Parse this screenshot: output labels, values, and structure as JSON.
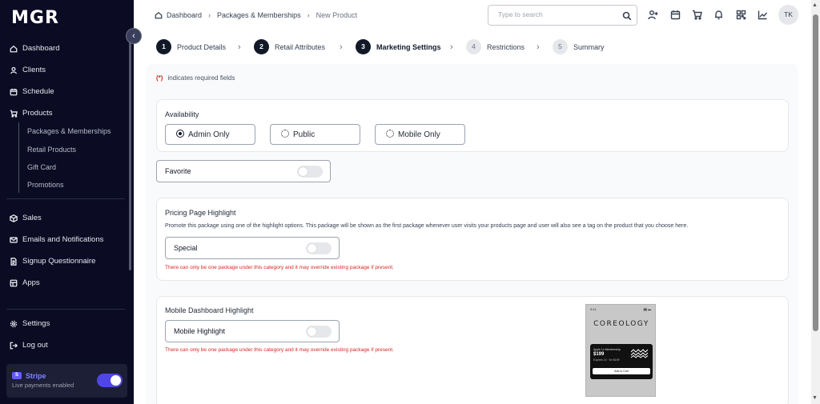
{
  "app": {
    "logo": "MGR"
  },
  "sidebar": {
    "items": [
      {
        "label": "Dashboard",
        "icon": "home-icon"
      },
      {
        "label": "Clients",
        "icon": "user-icon"
      },
      {
        "label": "Schedule",
        "icon": "calendar-icon"
      },
      {
        "label": "Products",
        "icon": "cart-icon"
      },
      {
        "label": "Sales",
        "icon": "box-icon"
      },
      {
        "label": "Emails and Notifications",
        "icon": "mail-icon"
      },
      {
        "label": "Signup Questionnaire",
        "icon": "document-icon"
      },
      {
        "label": "Apps",
        "icon": "apps-icon"
      }
    ],
    "product_subitems": [
      "Packages & Memberships",
      "Retail Products",
      "Gift Card",
      "Promotions"
    ],
    "bottom": [
      {
        "label": "Settings",
        "icon": "gear-icon"
      },
      {
        "label": "Log out",
        "icon": "logout-icon"
      }
    ],
    "stripe": {
      "name": "Stripe",
      "status": "Live payments enabled",
      "enabled": true
    }
  },
  "header": {
    "breadcrumb": [
      "Dashboard",
      "Packages & Memberships",
      "New Product"
    ],
    "search_placeholder": "Type to search",
    "icons": [
      "add-user-icon",
      "calendar-icon",
      "cart-icon",
      "bell-icon",
      "qr-code-icon",
      "chart-icon"
    ],
    "avatar": "TK"
  },
  "steps": [
    {
      "num": "1",
      "label": "Product Details",
      "state": "done"
    },
    {
      "num": "2",
      "label": "Retail Attributes",
      "state": "done"
    },
    {
      "num": "3",
      "label": "Marketing Settings",
      "state": "active"
    },
    {
      "num": "4",
      "label": "Restrictions",
      "state": "pending"
    },
    {
      "num": "5",
      "label": "Summary",
      "state": "pending"
    }
  ],
  "form": {
    "required_marker": "(*)",
    "required_note": "indicates required fields",
    "availability": {
      "title": "Availability",
      "options": [
        "Admin Only",
        "Public",
        "Mobile Only"
      ],
      "selected": "Admin Only"
    },
    "favorite": {
      "label": "Favorite",
      "on": false
    },
    "pricing_highlight": {
      "title": "Pricing Page Highlight",
      "description": "Promote this package using one of the highlight options. This package will be shown as the first package whenever user visits your products page and user will also see a tag on the product that you choose here.",
      "toggle_label": "Special",
      "on": false,
      "warning": "There can only be one package under this category and it may override existing package if present."
    },
    "mobile_highlight": {
      "title": "Mobile Dashboard Highlight",
      "toggle_label": "Mobile Highlight",
      "on": false,
      "warning": "There can only be one package under this category and it may override existing package if present."
    }
  },
  "preview": {
    "time": "9:41",
    "brand": "COREOLOGY",
    "card_line1": "Apple 1x Membership",
    "card_price": "$199",
    "card_line3": "Expires 14 · for $199",
    "button": "Add to Cart"
  }
}
